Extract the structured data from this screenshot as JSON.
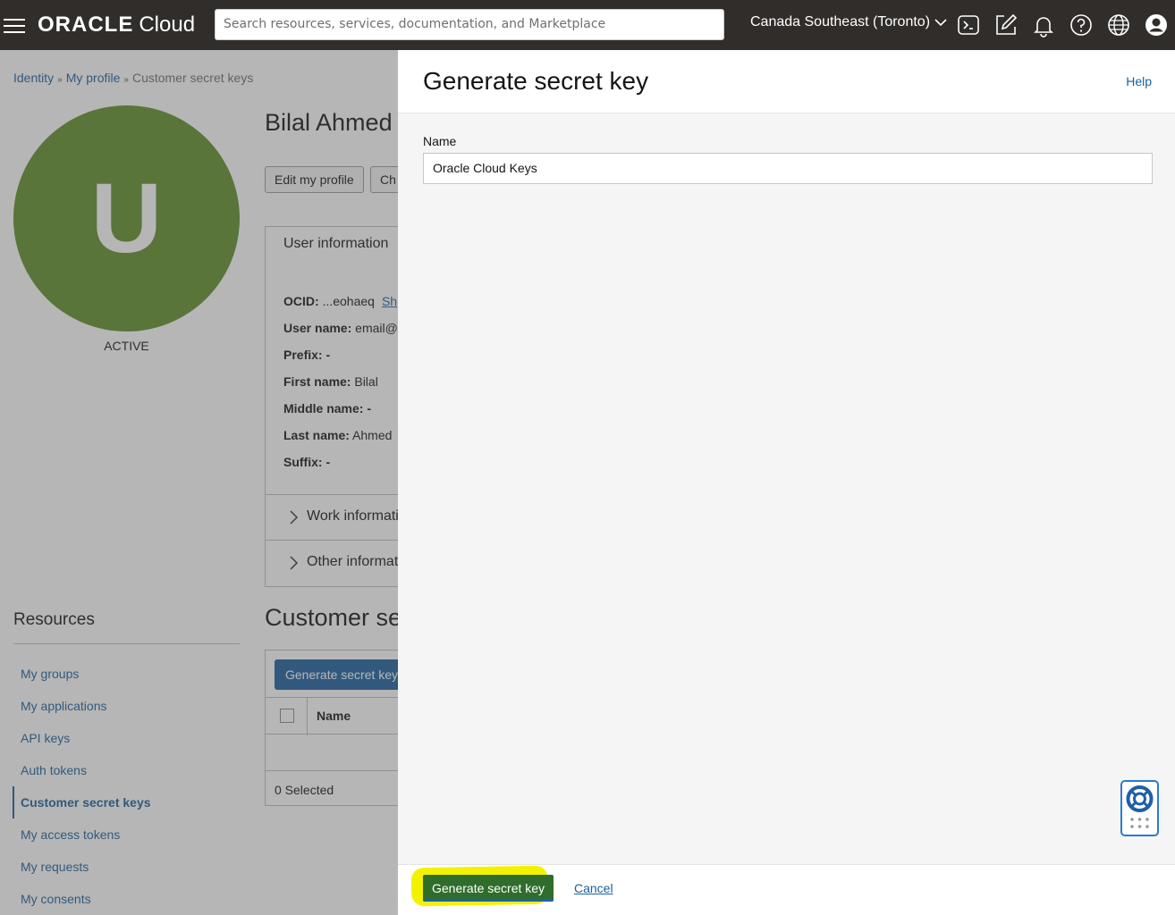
{
  "topbar": {
    "logo_brand": "ORACLE",
    "logo_product": "Cloud",
    "search_placeholder": "Search resources, services, documentation, and Marketplace",
    "region": "Canada Southeast (Toronto)",
    "icons": [
      "menu-icon",
      "cloud-shell-icon",
      "code-editor-icon",
      "bell-icon",
      "help-icon",
      "globe-icon",
      "user-icon"
    ]
  },
  "breadcrumb": {
    "items": [
      "Identity",
      "My profile"
    ],
    "current": "Customer secret keys"
  },
  "profile": {
    "avatar_letter": "U",
    "avatar_color": "#5f8f2a",
    "status": "ACTIVE",
    "name": "Bilal Ahmed",
    "edit_button": "Edit my profile",
    "change_button": "Ch"
  },
  "user_info": {
    "title": "User information",
    "ocid_label": "OCID:",
    "ocid_value": "...eohaeq",
    "ocid_link": "Sh",
    "username_label": "User name:",
    "username_value": "email@",
    "prefix_label": "Prefix:",
    "prefix_value": "-",
    "first_label": "First name:",
    "first_value": "Bilal",
    "middle_label": "Middle name:",
    "middle_value": "-",
    "last_label": "Last name:",
    "last_value": "Ahmed",
    "suffix_label": "Suffix:",
    "suffix_value": "-",
    "work_info": "Work informati",
    "other_info": "Other informat"
  },
  "resources": {
    "title": "Resources",
    "items": [
      "My groups",
      "My applications",
      "API keys",
      "Auth tokens",
      "Customer secret keys",
      "My access tokens",
      "My requests",
      "My consents"
    ],
    "active": "Customer secret keys"
  },
  "keys_section": {
    "title": "Customer se",
    "generate_button": "Generate secret key",
    "column_name": "Name",
    "selected": "0 Selected"
  },
  "drawer": {
    "title": "Generate secret key",
    "help": "Help",
    "name_label": "Name",
    "name_value": "Oracle Cloud Keys",
    "submit": "Generate secret key",
    "cancel": "Cancel",
    "highlight_color": "#f2f200"
  }
}
